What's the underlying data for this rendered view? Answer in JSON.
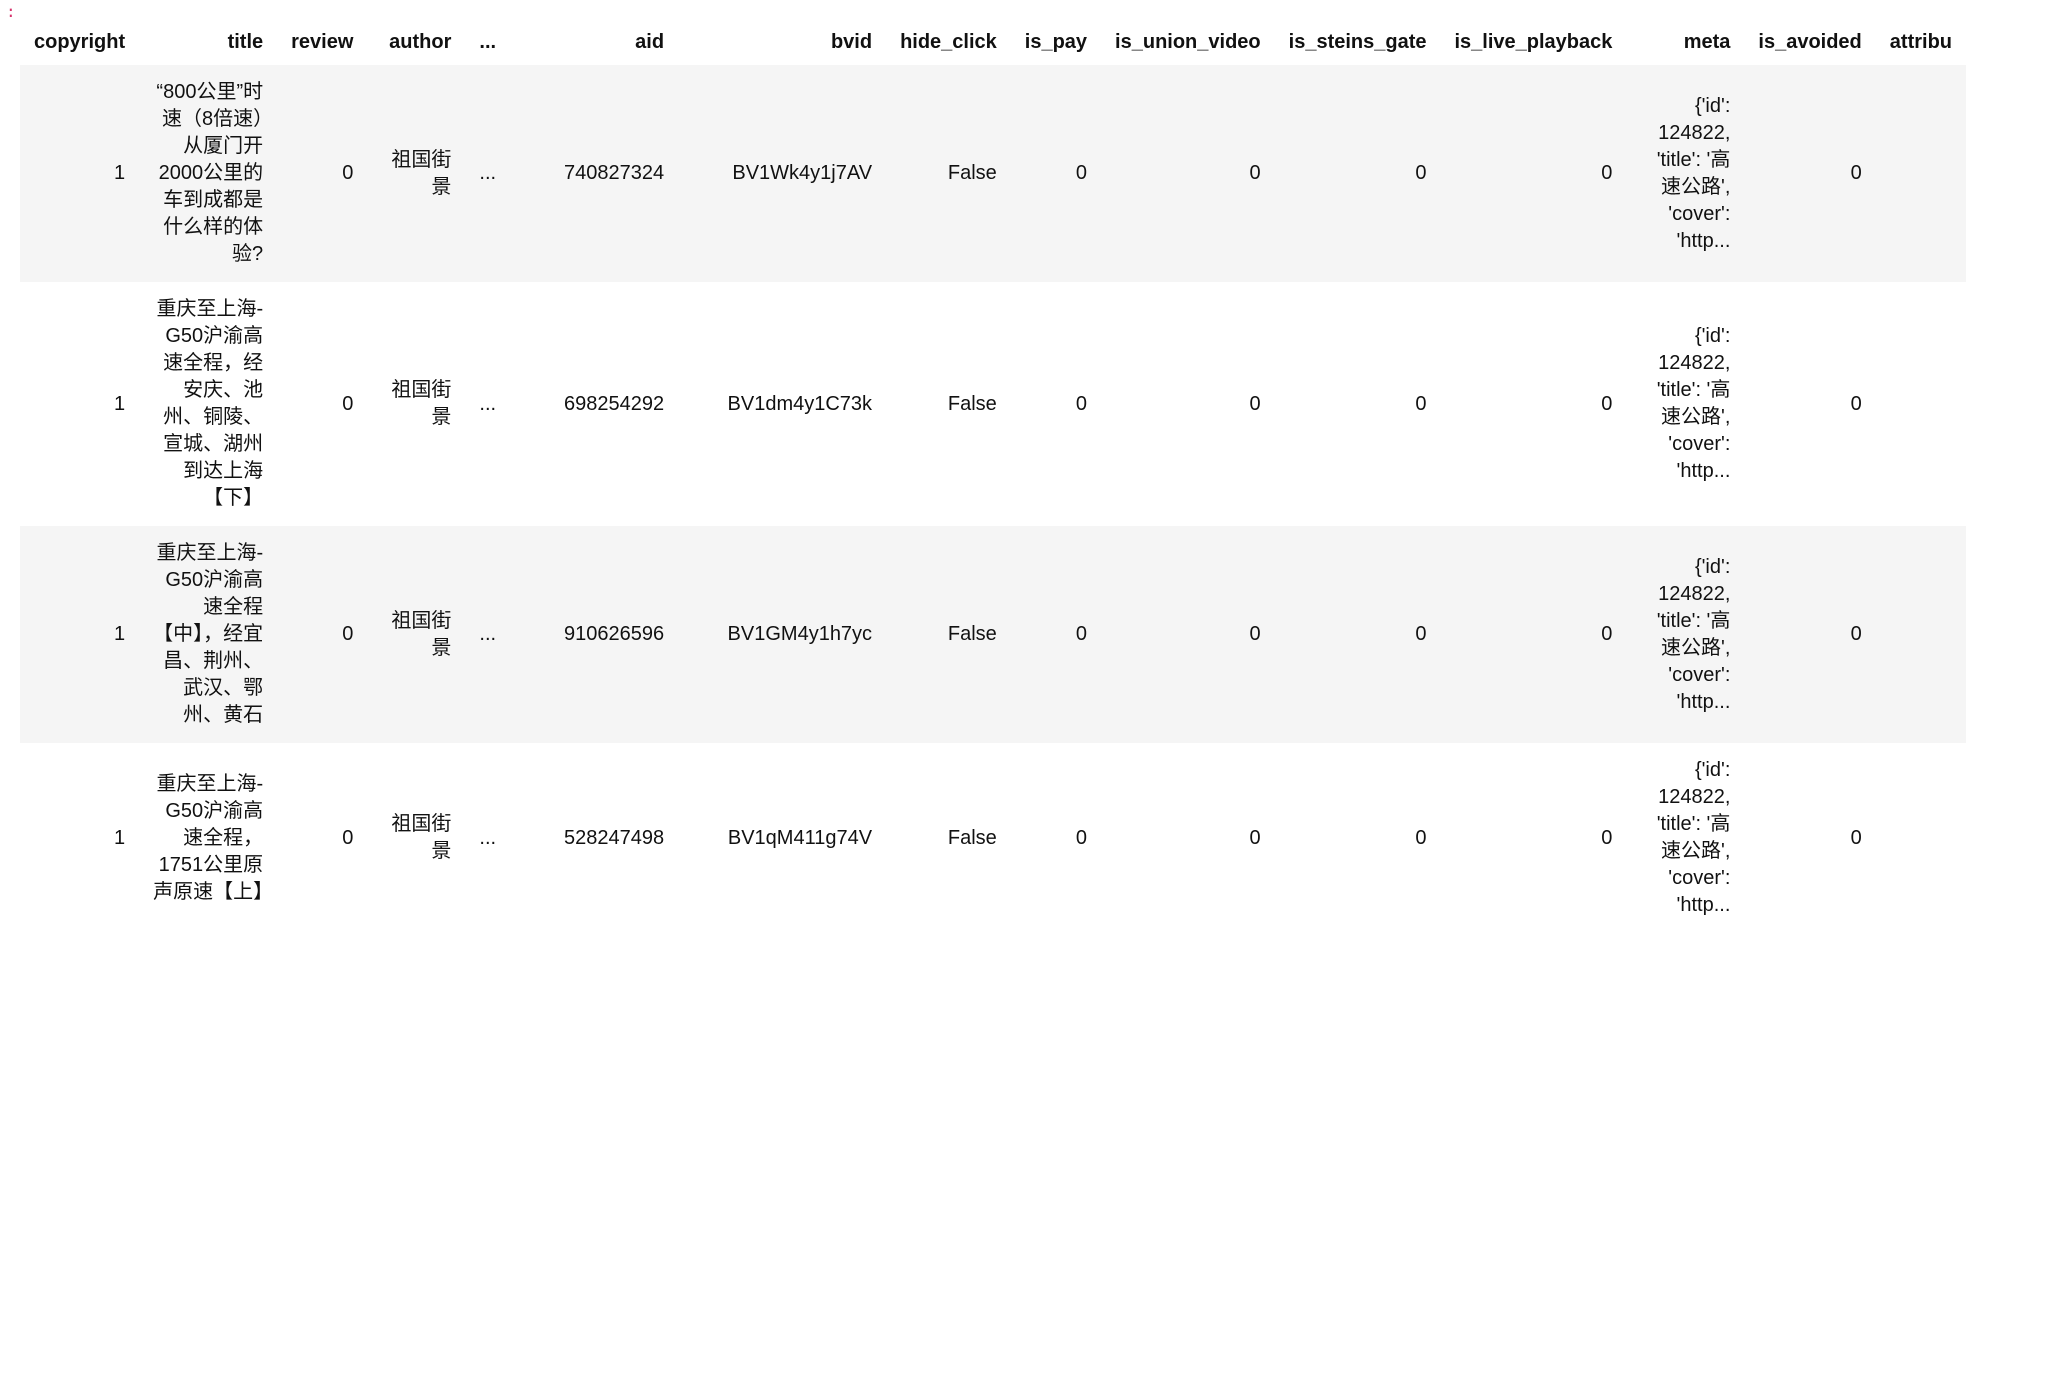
{
  "prompt_marker": ":",
  "columns": [
    "copyright",
    "title",
    "review",
    "author",
    "...",
    "aid",
    "bvid",
    "hide_click",
    "is_pay",
    "is_union_video",
    "is_steins_gate",
    "is_live_playback",
    "meta",
    "is_avoided",
    "attribu"
  ],
  "rows": [
    {
      "copyright": "1",
      "title": "“800公里”时速（8倍速）从厦门开2000公里的车到成都是什么样的体验?",
      "review": "0",
      "author": "祖国街景",
      "ellipsis": "...",
      "aid": "740827324",
      "bvid": "BV1Wk4y1j7AV",
      "hide_click": "False",
      "is_pay": "0",
      "is_union_video": "0",
      "is_steins_gate": "0",
      "is_live_playback": "0",
      "meta": "{'id': 124822, 'title': '高速公路', 'cover': 'http...",
      "is_avoided": "0"
    },
    {
      "copyright": "1",
      "title": "重庆至上海-G50沪渝高速全程，经安庆、池州、铜陵、宣城、湖州到达上海【下】",
      "review": "0",
      "author": "祖国街景",
      "ellipsis": "...",
      "aid": "698254292",
      "bvid": "BV1dm4y1C73k",
      "hide_click": "False",
      "is_pay": "0",
      "is_union_video": "0",
      "is_steins_gate": "0",
      "is_live_playback": "0",
      "meta": "{'id': 124822, 'title': '高速公路', 'cover': 'http...",
      "is_avoided": "0"
    },
    {
      "copyright": "1",
      "title": "重庆至上海-G50沪渝高速全程【中】，经宜昌、荆州、武汉、鄂州、黄石",
      "review": "0",
      "author": "祖国街景",
      "ellipsis": "...",
      "aid": "910626596",
      "bvid": "BV1GM4y1h7yc",
      "hide_click": "False",
      "is_pay": "0",
      "is_union_video": "0",
      "is_steins_gate": "0",
      "is_live_playback": "0",
      "meta": "{'id': 124822, 'title': '高速公路', 'cover': 'http...",
      "is_avoided": "0"
    },
    {
      "copyright": "1",
      "title": "重庆至上海-G50沪渝高速全程，1751公里原声原速【上】",
      "review": "0",
      "author": "祖国街景",
      "ellipsis": "...",
      "aid": "528247498",
      "bvid": "BV1qM411g74V",
      "hide_click": "False",
      "is_pay": "0",
      "is_union_video": "0",
      "is_steins_gate": "0",
      "is_live_playback": "0",
      "meta": "{'id': 124822, 'title': '高速公路', 'cover': 'http...",
      "is_avoided": "0"
    }
  ]
}
